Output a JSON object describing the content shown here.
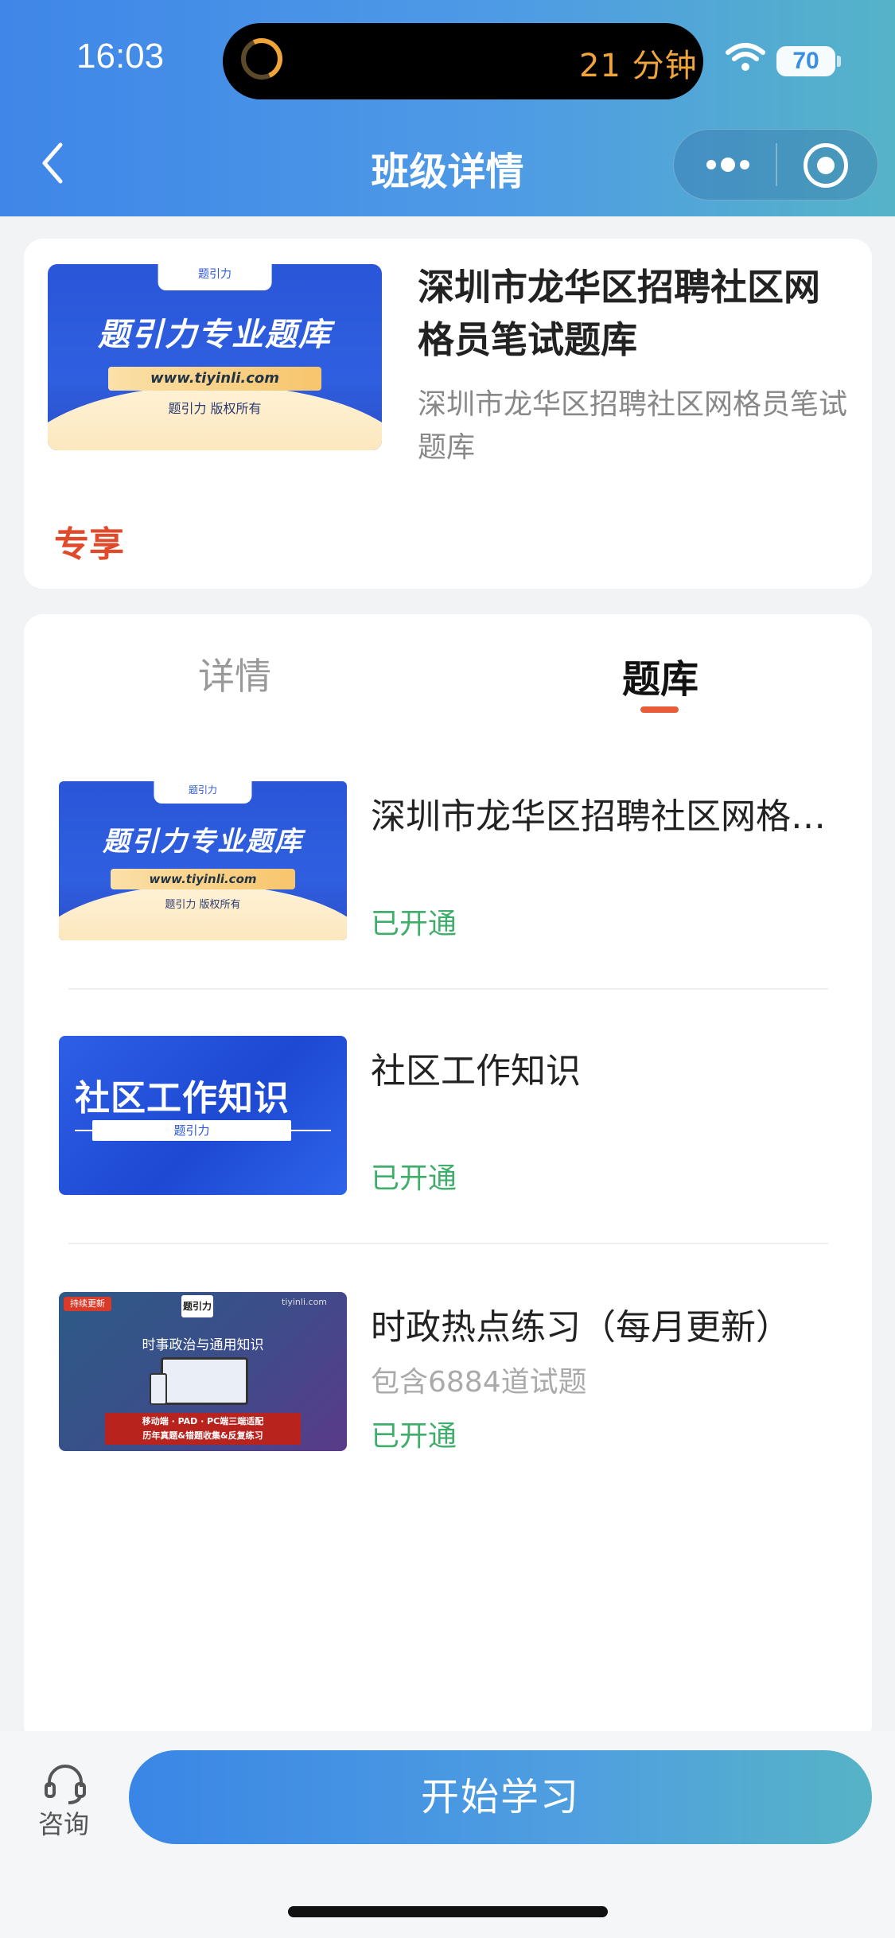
{
  "status_bar": {
    "time": "16:03",
    "timer": "21 分钟",
    "battery": "70"
  },
  "header": {
    "title": "班级详情",
    "back_icon": "chevron-left-icon",
    "more_icon": "more-dots-icon",
    "close_icon": "target-circle-icon"
  },
  "course": {
    "title": "深圳市龙华区招聘社区网格员笔试题库",
    "subtitle": "深圳市龙华区招聘社区网格员笔试题库",
    "tag": "专享",
    "cover": {
      "tab": "题引力",
      "headline": "题引力专业题库",
      "url": "www.tiyinli.com",
      "copyright": "题引力 版权所有"
    }
  },
  "tabs": [
    {
      "label": "详情",
      "active": false
    },
    {
      "label": "题库",
      "active": true
    }
  ],
  "items": [
    {
      "title": "深圳市龙华区招聘社区网格员笔试题库",
      "meta": "",
      "status": "已开通",
      "cover": {
        "tab": "题引力",
        "headline": "题引力专业题库",
        "url": "www.tiyinli.com",
        "copyright": "题引力 版权所有"
      }
    },
    {
      "title": "社区工作知识",
      "meta": "",
      "status": "已开通",
      "cover": {
        "headline": "社区工作知识",
        "tag": "题引力"
      }
    },
    {
      "title": "时政热点练习（每月更新）",
      "meta": "包含6884道试题",
      "status": "已开通",
      "cover": {
        "badge": "持续更新",
        "logo": "题引力",
        "site": "tiyinli.com",
        "headline": "时事政治与通用知识",
        "line1": "移动端 · PAD · PC端三端适配",
        "line2": "历年真题&错题收集&反复练习"
      }
    }
  ],
  "bottom_bar": {
    "consult_label": "咨询",
    "consult_icon": "headset-icon",
    "start_label": "开始学习"
  },
  "colors": {
    "accent": "#e04a2a",
    "status_green": "#3fae6b",
    "header_start": "#3f86e8",
    "header_end": "#55b3c8"
  }
}
